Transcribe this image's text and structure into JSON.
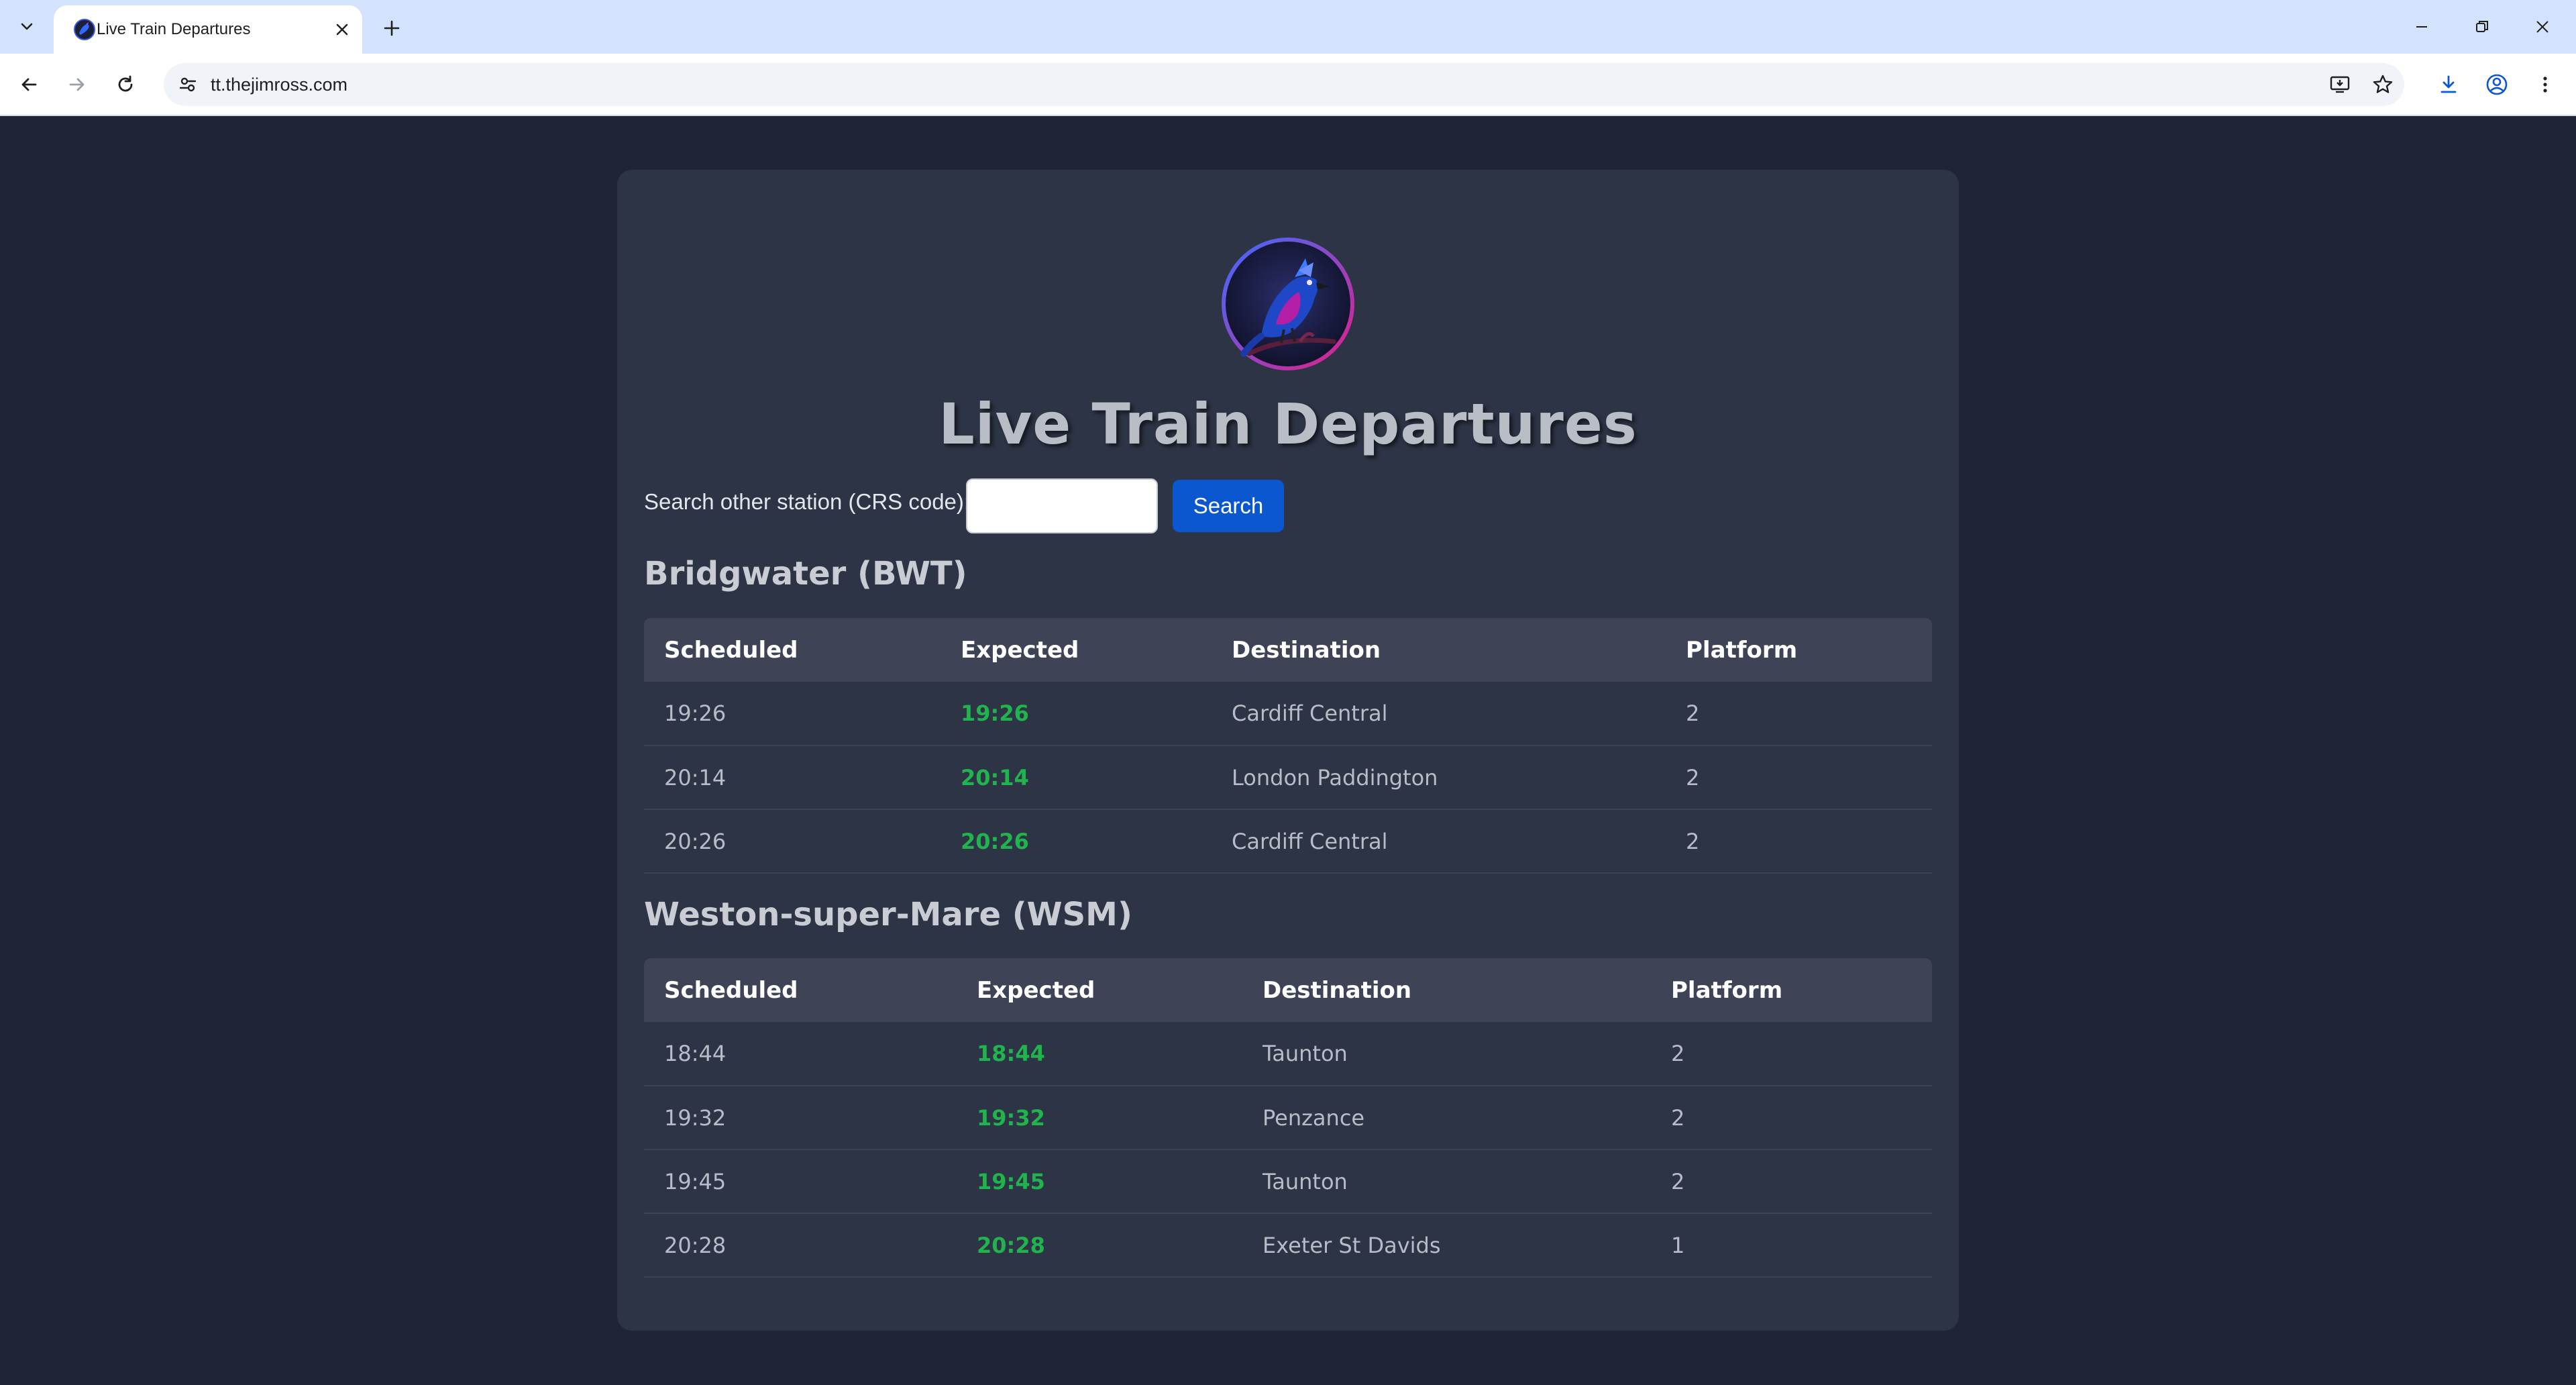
{
  "browser": {
    "tab_title": "Live Train Departures",
    "url": "tt.thejimross.com"
  },
  "page": {
    "title": "Live Train Departures",
    "search": {
      "label": "Search other station (CRS code):",
      "input_value": "",
      "button_label": "Search"
    },
    "stations": [
      {
        "name": "Bridgwater (BWT)",
        "headers": [
          "Scheduled",
          "Expected",
          "Destination",
          "Platform"
        ],
        "rows": [
          {
            "scheduled": "19:26",
            "expected": "19:26",
            "destination": "Cardiff Central",
            "platform": "2"
          },
          {
            "scheduled": "20:14",
            "expected": "20:14",
            "destination": "London Paddington",
            "platform": "2"
          },
          {
            "scheduled": "20:26",
            "expected": "20:26",
            "destination": "Cardiff Central",
            "platform": "2"
          }
        ]
      },
      {
        "name": "Weston-super-Mare (WSM)",
        "headers": [
          "Scheduled",
          "Expected",
          "Destination",
          "Platform"
        ],
        "rows": [
          {
            "scheduled": "18:44",
            "expected": "18:44",
            "destination": "Taunton",
            "platform": "2"
          },
          {
            "scheduled": "19:32",
            "expected": "19:32",
            "destination": "Penzance",
            "platform": "2"
          },
          {
            "scheduled": "19:45",
            "expected": "19:45",
            "destination": "Taunton",
            "platform": "2"
          },
          {
            "scheduled": "20:28",
            "expected": "20:28",
            "destination": "Exeter St Davids",
            "platform": "1"
          }
        ]
      }
    ]
  },
  "colors": {
    "page_background": "#1f2536",
    "card_background": "#2d3446",
    "header_row": "#3e4456",
    "on_time_green": "#21b34c",
    "search_button": "#0b57d0",
    "tabstrip": "#d3e3fd"
  },
  "icons": {
    "logo": "blue-jay-bird-logo",
    "tab_favicon": "blue-jay-bird-favicon"
  }
}
